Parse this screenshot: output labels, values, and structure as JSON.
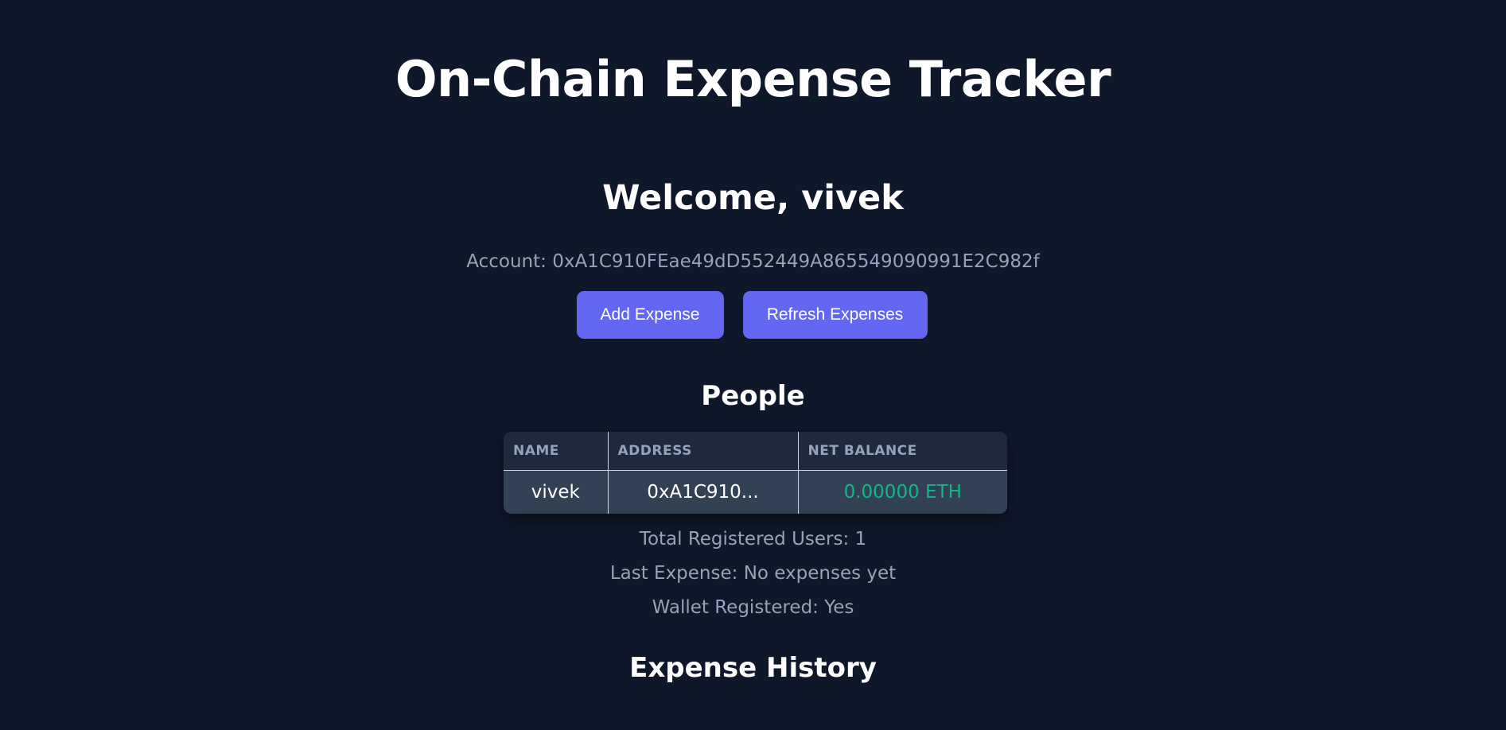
{
  "header": {
    "title": "On-Chain Expense Tracker"
  },
  "welcome": {
    "text": "Welcome, vivek",
    "account_line": "Account: 0xA1C910FEae49dD552449A865549090991E2C982f"
  },
  "actions": {
    "add_expense_label": "Add Expense",
    "refresh_expenses_label": "Refresh Expenses"
  },
  "people": {
    "title": "People",
    "columns": [
      "NAME",
      "ADDRESS",
      "NET BALANCE"
    ],
    "rows": [
      {
        "name": "vivek",
        "address": "0xA1C910...",
        "net_balance": "0.00000 ETH"
      }
    ]
  },
  "stats": {
    "total_registered_users": "Total Registered Users: 1",
    "last_expense": "Last Expense: No expenses yet",
    "wallet_registered": "Wallet Registered: Yes"
  },
  "history": {
    "title": "Expense History"
  },
  "colors": {
    "background": "#0f172a",
    "accent": "#6366f1",
    "positive_balance": "#10b981",
    "muted_text": "#94a3b8"
  }
}
